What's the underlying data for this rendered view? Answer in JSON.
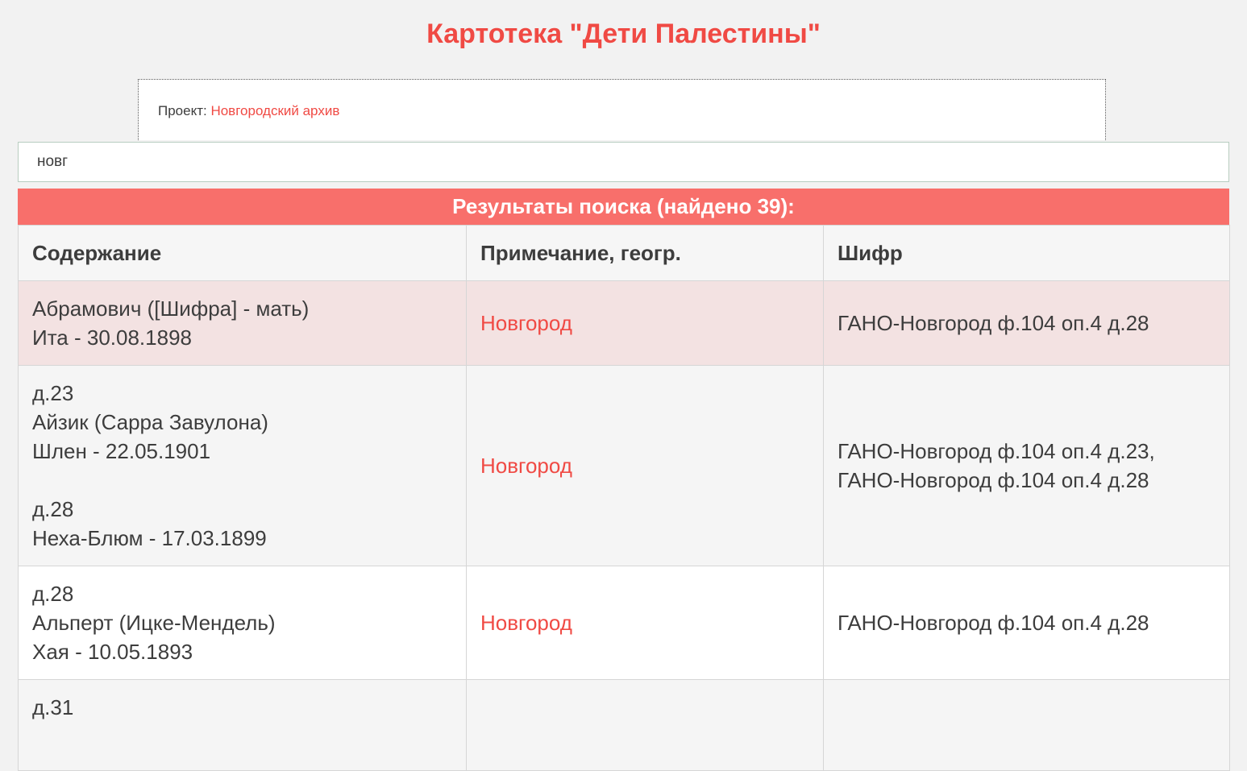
{
  "page": {
    "title": "Картотека \"Дети Палестины\""
  },
  "project": {
    "label": "Проект: ",
    "link": "Новгородский архив"
  },
  "search": {
    "value": "новг"
  },
  "results": {
    "header": "Результаты поиска (найдено 39):",
    "columns": {
      "content": "Содержание",
      "note": "Примечание, геогр.",
      "cipher": "Шифр"
    },
    "rows": [
      {
        "content": [
          "Абрамович ([Шифра] - мать)",
          "Ита - 30.08.1898"
        ],
        "note": "Новгород",
        "cipher": [
          "ГАНО-Новгород ф.104 оп.4 д.28"
        ]
      },
      {
        "content": [
          "д.23",
          "Айзик (Сарра Завулона)",
          "Шлен - 22.05.1901",
          "",
          "д.28",
          "Неха-Блюм - 17.03.1899"
        ],
        "note": "Новгород",
        "cipher": [
          "ГАНО-Новгород ф.104 оп.4 д.23,",
          "ГАНО-Новгород ф.104 оп.4 д.28"
        ]
      },
      {
        "content": [
          "д.28",
          "Альперт (Ицке-Мендель)",
          "Хая - 10.05.1893"
        ],
        "note": "Новгород",
        "cipher": [
          "ГАНО-Новгород ф.104 оп.4 д.28"
        ]
      },
      {
        "content": [
          "д.31"
        ],
        "note": "",
        "cipher": []
      }
    ]
  },
  "colors": {
    "accent": "#f04a44",
    "header_bar": "#f86f6b",
    "highlight_row": "#f3e2e2"
  }
}
